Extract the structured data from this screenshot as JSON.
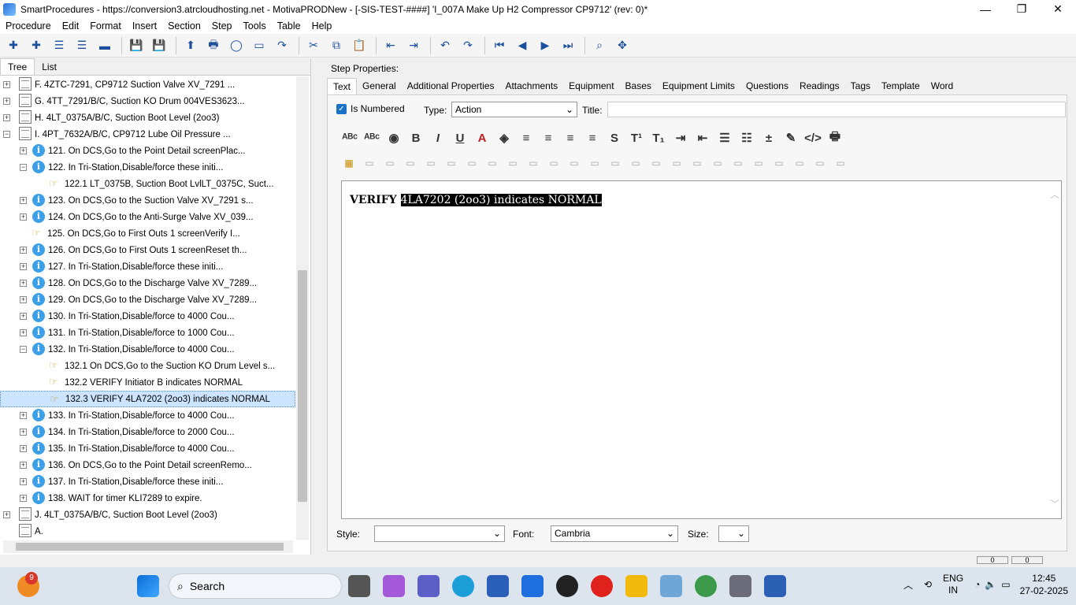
{
  "window": {
    "title": "SmartProcedures - https://conversion3.atrcloudhosting.net - MotivaPRODNew - [-SIS-TEST-####] 'I_007A Make Up H2 Compressor CP9712' (rev: 0)*",
    "minimize": "—",
    "restore": "❐",
    "close": "✕"
  },
  "menu": [
    "Procedure",
    "Edit",
    "Format",
    "Insert",
    "Section",
    "Step",
    "Tools",
    "Table",
    "Help"
  ],
  "toolbar": {
    "icons": [
      "add-icon",
      "add-child-icon",
      "indent-doc-icon",
      "doc-list-icon",
      "remove-icon",
      "save-server-icon",
      "save-icon",
      "upload-icon",
      "print-icon",
      "refresh-icon",
      "frame-icon",
      "redo-disabled-icon",
      "cut-icon",
      "copy-icon",
      "paste-icon",
      "outdent-icon",
      "indent-icon",
      "undo-icon",
      "redo-icon",
      "first-icon",
      "prev-icon",
      "next-icon",
      "last-icon",
      "binoculars-icon",
      "move-icon"
    ],
    "glyphs": [
      "✚",
      "✚",
      "☰",
      "☰",
      "▬",
      "💾",
      "💾",
      "⬆",
      "🖶",
      "◯",
      "▭",
      "↷",
      "✂",
      "⧉",
      "📋",
      "⇤",
      "⇥",
      "↶",
      "↷",
      "⏮",
      "◀",
      "▶",
      "⏭",
      "⌕",
      "✥"
    ]
  },
  "left": {
    "tabs": [
      "Tree",
      "List"
    ],
    "tree": [
      {
        "label": "F. 4ZTC-7291, CP9712 Suction Valve XV_7291 ...",
        "icon": "doc",
        "expander": "+",
        "indent": 0
      },
      {
        "label": "G. 4TT_7291/B/C, Suction KO Drum 004VES3623...",
        "icon": "doc",
        "expander": "+",
        "indent": 0
      },
      {
        "label": "H. 4LT_0375A/B/C, Suction Boot Level (2oo3)",
        "icon": "doc",
        "expander": "+",
        "indent": 0
      },
      {
        "label": "I. 4PT_7632A/B/C, CP9712 Lube Oil Pressure ...",
        "icon": "doc",
        "expander": "−",
        "indent": 0
      },
      {
        "label": "121. On DCS,Go to the Point Detail screenPlac...",
        "icon": "info",
        "expander": "+",
        "indent": 1
      },
      {
        "label": "122. In Tri-Station,Disable/force these initi...",
        "icon": "info",
        "expander": "−",
        "indent": 1
      },
      {
        "label": "122.1 LT_0375B, Suction Boot LvlLT_0375C, Suct...",
        "icon": "hand",
        "expander": "",
        "indent": 2
      },
      {
        "label": "123. On DCS,Go to the Suction Valve XV_7291 s...",
        "icon": "info",
        "expander": "+",
        "indent": 1
      },
      {
        "label": "124. On DCS,Go to the Anti-Surge Valve XV_039...",
        "icon": "info",
        "expander": "+",
        "indent": 1
      },
      {
        "label": "125. On DCS,Go to First Outs 1 screenVerify I...",
        "icon": "hand",
        "expander": "",
        "indent": 1
      },
      {
        "label": "126. On DCS,Go to First Outs 1 screenReset th...",
        "icon": "info",
        "expander": "+",
        "indent": 1
      },
      {
        "label": "127. In Tri-Station,Disable/force these initi...",
        "icon": "info",
        "expander": "+",
        "indent": 1
      },
      {
        "label": "128. On DCS,Go to the Discharge Valve XV_7289...",
        "icon": "info",
        "expander": "+",
        "indent": 1
      },
      {
        "label": "129. On DCS,Go to the Discharge Valve XV_7289...",
        "icon": "info",
        "expander": "+",
        "indent": 1
      },
      {
        "label": "130. In Tri-Station,Disable/force to 4000 Cou...",
        "icon": "info",
        "expander": "+",
        "indent": 1
      },
      {
        "label": "131. In Tri-Station,Disable/force to 1000 Cou...",
        "icon": "info",
        "expander": "+",
        "indent": 1
      },
      {
        "label": "132. In Tri-Station,Disable/force to 4000 Cou...",
        "icon": "info",
        "expander": "−",
        "indent": 1
      },
      {
        "label": "132.1 On DCS,Go to the Suction KO Drum Level s...",
        "icon": "hand",
        "expander": "",
        "indent": 2
      },
      {
        "label": "132.2 VERIFY Initiator B indicates NORMAL",
        "icon": "hand",
        "expander": "",
        "indent": 2
      },
      {
        "label": "132.3 VERIFY 4LA7202 (2oo3) indicates NORMAL",
        "icon": "hand",
        "expander": "",
        "indent": 2,
        "selected": true
      },
      {
        "label": "133. In Tri-Station,Disable/force to 4000 Cou...",
        "icon": "info",
        "expander": "+",
        "indent": 1
      },
      {
        "label": "134. In Tri-Station,Disable/force to 2000 Cou...",
        "icon": "info",
        "expander": "+",
        "indent": 1
      },
      {
        "label": "135. In Tri-Station,Disable/force to 4000 Cou...",
        "icon": "info",
        "expander": "+",
        "indent": 1
      },
      {
        "label": "136. On DCS,Go to the Point Detail screenRemo...",
        "icon": "info",
        "expander": "+",
        "indent": 1
      },
      {
        "label": "137. In Tri-Station,Disable/force these initi...",
        "icon": "info",
        "expander": "+",
        "indent": 1
      },
      {
        "label": "138. WAIT for timer KLI7289 to expire.",
        "icon": "info",
        "expander": "+",
        "indent": 1
      },
      {
        "label": "J. 4LT_0375A/B/C, Suction Boot Level (2oo3)",
        "icon": "doc",
        "expander": "+",
        "indent": 0
      },
      {
        "label": "A.",
        "icon": "doc",
        "expander": "",
        "indent": 0
      }
    ]
  },
  "right": {
    "step_properties": "Step Properties:",
    "tabs": [
      "Text",
      "General",
      "Additional Properties",
      "Attachments",
      "Equipment",
      "Bases",
      "Equipment Limits",
      "Questions",
      "Readings",
      "Tags",
      "Template",
      "Word"
    ],
    "is_numbered": "Is Numbered",
    "type_label": "Type:",
    "type_value": "Action",
    "title_label": "Title:",
    "format_glyphs": [
      "ᴬᴮᶜ",
      "ᴬᴮᶜ",
      "◉",
      "B",
      "I",
      "U",
      "A",
      "◈",
      "≡",
      "≡",
      "≡",
      "≡",
      "S",
      "T¹",
      "T₁",
      "⇥",
      "⇤",
      "☰",
      "☷",
      "±",
      "✎",
      "</>",
      "🖶"
    ],
    "editor_prefix": "VERIFY ",
    "editor_highlight": "4LA7202 (2oo3) indicates NORMAL",
    "style_label": "Style:",
    "font_label": "Font:",
    "font_value": "Cambria",
    "size_label": "Size:"
  },
  "status": [
    "0",
    "0"
  ],
  "taskbar": {
    "search": "Search",
    "badge": "9",
    "lang": "ENG",
    "region": "IN",
    "time": "12:45",
    "date": "27-02-2025"
  },
  "colors": {
    "selection": "#cce4ff",
    "info_icon": "#3ba0e8",
    "checkbox": "#1a73c9"
  }
}
